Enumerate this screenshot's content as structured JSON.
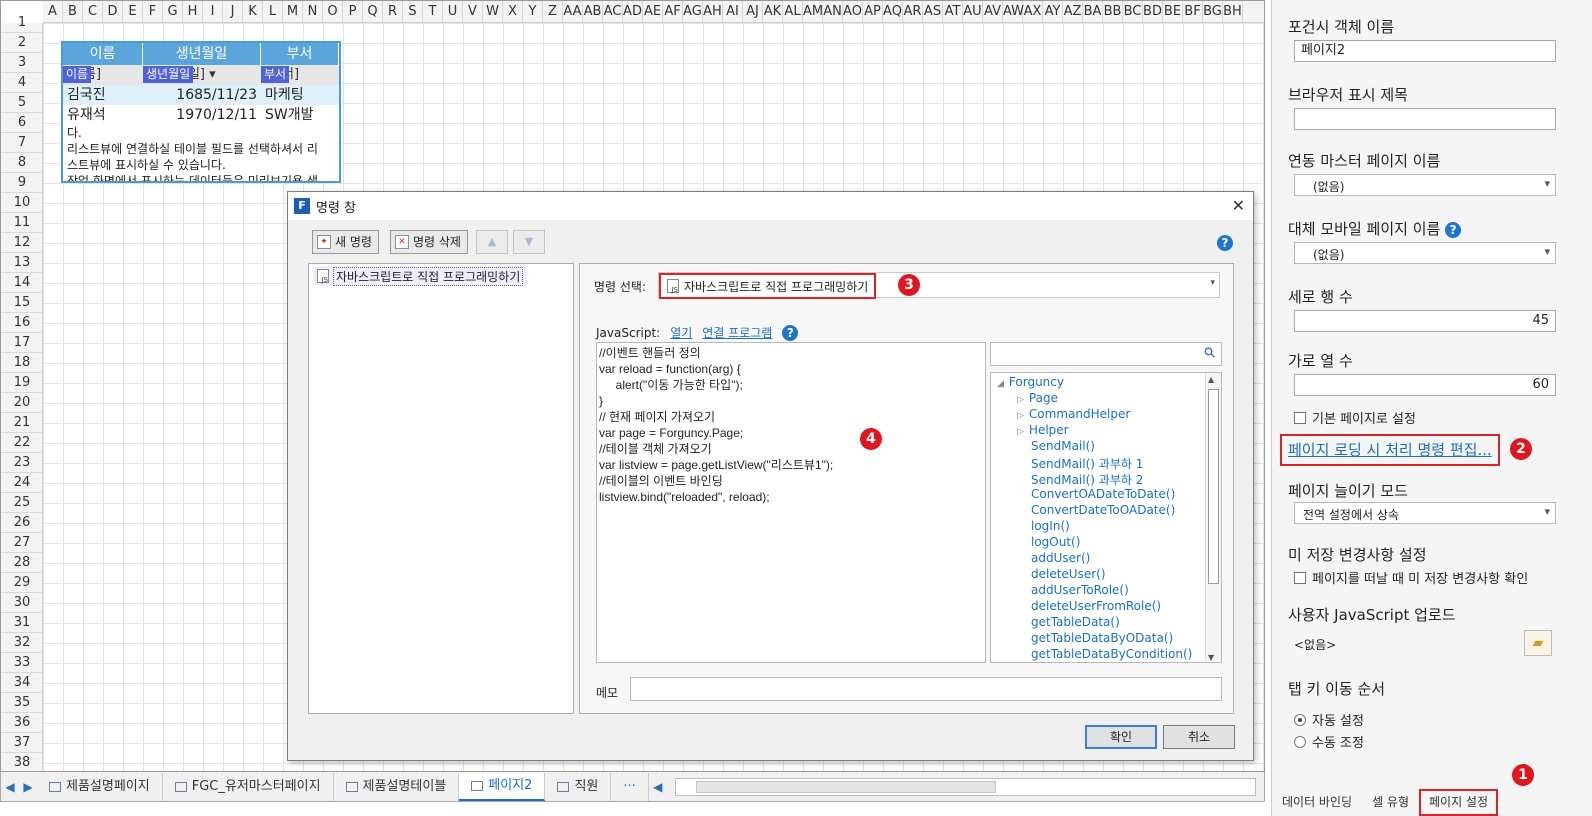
{
  "sheet": {
    "columns": [
      "A",
      "B",
      "C",
      "D",
      "E",
      "F",
      "G",
      "H",
      "I",
      "J",
      "K",
      "L",
      "M",
      "N",
      "O",
      "P",
      "Q",
      "R",
      "S",
      "T",
      "U",
      "V",
      "W",
      "X",
      "Y",
      "Z",
      "AA",
      "AB",
      "AC",
      "AD",
      "AE",
      "AF",
      "AG",
      "AH",
      "AI",
      "AJ",
      "AK",
      "AL",
      "AM",
      "AN",
      "AO",
      "AP",
      "AQ",
      "AR",
      "AS",
      "AT",
      "AU",
      "AV",
      "AW",
      "AX",
      "AY",
      "AZ",
      "BA",
      "BB",
      "BC",
      "BD",
      "BE",
      "BF",
      "BG",
      "BH"
    ],
    "rows": [
      "1",
      "2",
      "3",
      "4",
      "5",
      "6",
      "7",
      "8",
      "9",
      "10",
      "11",
      "12",
      "13",
      "14",
      "15",
      "16",
      "17",
      "18",
      "19",
      "20",
      "21",
      "22",
      "23",
      "24",
      "25",
      "26",
      "27",
      "28",
      "29",
      "30",
      "31",
      "32",
      "33",
      "34",
      "35",
      "36",
      "37",
      "38"
    ]
  },
  "listview": {
    "headers": [
      "이름",
      "생년월일",
      "부서"
    ],
    "filter": [
      "[이름]",
      "[생년월일]",
      "[부서]"
    ],
    "tags": [
      "이름",
      "생년월일",
      "부서"
    ],
    "rows": [
      [
        "김국진",
        "1685/11/23",
        "마케팅"
      ],
      [
        "유재석",
        "1970/12/11",
        "SW개발"
      ]
    ],
    "note": "다.\n리스트뷰에 연결하실 테이블 필드를 선택하셔서 리\n스트뷰에 표시하실 수 있습니다.\n작업 화면에서 표시하는 데이터들은 미리보기용 샘"
  },
  "tabs": {
    "items": [
      "제품설명페이지",
      "FGC_유저마스터페이지",
      "제품설명테이블",
      "페이지2",
      "직원"
    ],
    "active_index": 3,
    "more": "···"
  },
  "panel": {
    "object_name_label": "포건시 객체 이름",
    "object_name_value": "페이지2",
    "browser_title_label": "브라우저 표시 제목",
    "browser_title_value": "",
    "master_page_label": "연동 마스터 페이지 이름",
    "master_page_value": "(없음)",
    "mobile_page_label": "대체 모바일 페이지 이름",
    "mobile_page_value": "(없음)",
    "row_count_label": "세로 행 수",
    "row_count_value": "45",
    "col_count_label": "가로 열 수",
    "col_count_value": "60",
    "default_page_label": "기본 페이지로 설정",
    "edit_loading_link": "페이지 로딩 시 처리 명령 편집...",
    "stretch_mode_label": "페이지 늘이기 모드",
    "stretch_mode_value": "전역 설정에서 상속",
    "unsaved_label": "미 저장 변경사항 설정",
    "unsaved_check": "페이지를 떠날 때 미 저장 변경사항 확인",
    "js_upload_label": "사용자 JavaScript 업로드",
    "js_upload_value": "<없음>",
    "tab_order_label": "탭 키 이동 순서",
    "tab_auto": "자동 설정",
    "tab_manual": "수동 조정",
    "bottom_tabs": [
      "데이터 바인딩",
      "셀 유형",
      "페이지 설정"
    ],
    "help": "?"
  },
  "dialog": {
    "title": "명령 창",
    "app_icon": "F",
    "new_cmd": "새 명령",
    "del_cmd": "명령 삭제",
    "cmd_item": "자바스크립트로 직접 프로그래밍하기",
    "select_label": "명령 선택:",
    "select_value": "자바스크립트로 직접 프로그래밍하기",
    "js_label": "JavaScript:",
    "open_link": "열기",
    "connect_link": "연결 프로그램",
    "code": "//이벤트 핸들러 정의\nvar reload = function(arg) {\n     alert(\"이동 가능한 타입\");\n}\n// 현재 페이지 가져오기\nvar page = Forguncy.Page;\n//테이블 객체 가져오기\nvar listview = page.getListView(\"리스트뷰1\");\n//테이블의 이벤트 바인딩\nlistview.bind(\"reloaded\", reload);",
    "tree": [
      {
        "label": "Forguncy",
        "level": 0,
        "arrow": "◢"
      },
      {
        "label": "Page",
        "level": 1,
        "arrow": "▷"
      },
      {
        "label": "CommandHelper",
        "level": 1,
        "arrow": "▷"
      },
      {
        "label": "Helper",
        "level": 1,
        "arrow": "▷"
      },
      {
        "label": "SendMail()",
        "level": 1,
        "arrow": ""
      },
      {
        "label": "SendMail() 과부하 1",
        "level": 1,
        "arrow": ""
      },
      {
        "label": "SendMail() 과부하 2",
        "level": 1,
        "arrow": ""
      },
      {
        "label": "ConvertOADateToDate()",
        "level": 1,
        "arrow": ""
      },
      {
        "label": "ConvertDateToOADate()",
        "level": 1,
        "arrow": ""
      },
      {
        "label": "logIn()",
        "level": 1,
        "arrow": ""
      },
      {
        "label": "logOut()",
        "level": 1,
        "arrow": ""
      },
      {
        "label": "addUser()",
        "level": 1,
        "arrow": ""
      },
      {
        "label": "deleteUser()",
        "level": 1,
        "arrow": ""
      },
      {
        "label": "addUserToRole()",
        "level": 1,
        "arrow": ""
      },
      {
        "label": "deleteUserFromRole()",
        "level": 1,
        "arrow": ""
      },
      {
        "label": "getTableData()",
        "level": 1,
        "arrow": ""
      },
      {
        "label": "getTableDataByOData()",
        "level": 1,
        "arrow": ""
      },
      {
        "label": "getTableDataByCondition()",
        "level": 1,
        "arrow": ""
      }
    ],
    "memo_label": "메모",
    "ok": "확인",
    "cancel": "취소",
    "close": "✕"
  },
  "badges": [
    "1",
    "2",
    "3",
    "4"
  ],
  "colors": {
    "highlight": "#d9242a",
    "accent": "#1a6fc4",
    "listview_header": "#5aa6dc"
  }
}
